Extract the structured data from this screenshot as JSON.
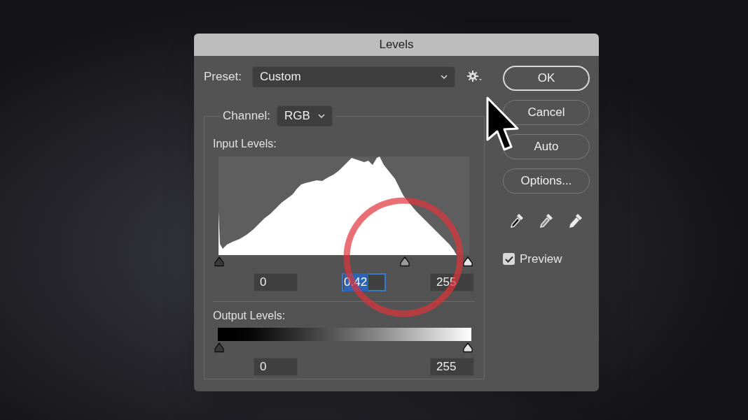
{
  "window": {
    "title": "Levels"
  },
  "preset": {
    "label": "Preset:",
    "value": "Custom"
  },
  "channel": {
    "label": "Channel:",
    "value": "RGB"
  },
  "input_levels": {
    "label": "Input Levels:",
    "sliders": [
      {
        "kind": "black",
        "level": 0
      },
      {
        "kind": "gray",
        "level": 0.746
      },
      {
        "kind": "white",
        "level": 1
      }
    ],
    "fields": [
      {
        "value": "0",
        "selected": false
      },
      {
        "value": "0.42",
        "selected": true
      },
      {
        "value": "255",
        "selected": false
      }
    ]
  },
  "output_levels": {
    "label": "Output Levels:",
    "sliders": [
      {
        "kind": "black",
        "level": 0
      },
      {
        "kind": "white",
        "level": 1
      }
    ],
    "fields": [
      {
        "value": "0",
        "selected": false
      },
      {
        "value": "255",
        "selected": false
      }
    ]
  },
  "buttons": [
    {
      "label": "OK",
      "default": true
    },
    {
      "label": "Cancel",
      "default": false
    },
    {
      "label": "Auto",
      "default": false
    },
    {
      "label": "Options...",
      "default": false
    }
  ],
  "eyedroppers": [
    {
      "kind": "black"
    },
    {
      "kind": "gray"
    },
    {
      "kind": "white"
    }
  ],
  "preview": {
    "label": "Preview",
    "checked": true
  }
}
